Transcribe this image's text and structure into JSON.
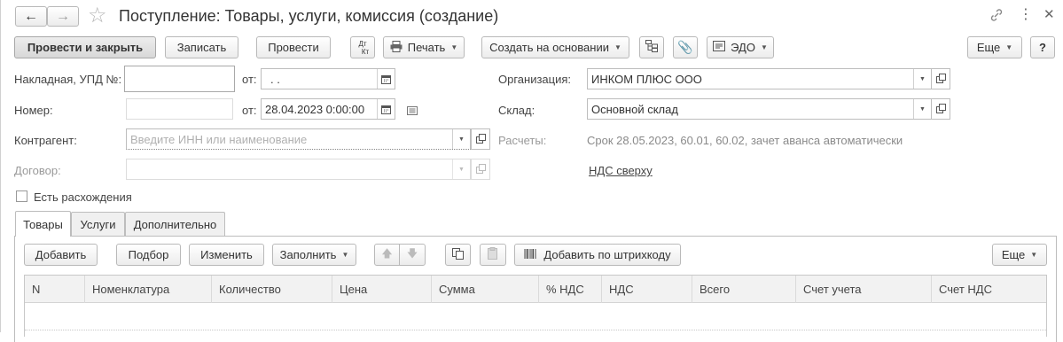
{
  "window": {
    "title": "Поступление: Товары, услуги, комиссия (создание)"
  },
  "toolbar": {
    "post_close": "Провести и закрыть",
    "save": "Записать",
    "post": "Провести",
    "dtkt_top": "Дт",
    "dtkt_bottom": "Кт",
    "print": "Печать",
    "create_based": "Создать на основании",
    "edo": "ЭДО",
    "more": "Еще",
    "help": "?"
  },
  "form": {
    "invoice_label": "Накладная, УПД №:",
    "invoice_number": "",
    "from_label_1": "от:",
    "invoice_date": " .  .",
    "number_label": "Номер:",
    "number_value": "",
    "from_label_2": "от:",
    "doc_date": "28.04.2023  0:00:00",
    "counterparty_label": "Контрагент:",
    "counterparty_placeholder": "Введите ИНН или наименование",
    "contract_label": "Договор:",
    "contract_value": "",
    "organization_label": "Организация:",
    "organization_value": "ИНКОМ ПЛЮС ООО",
    "warehouse_label": "Склад:",
    "warehouse_value": "Основной склад",
    "settlements_label": "Расчеты:",
    "settlements_value": "Срок 28.05.2023, 60.01, 60.02, зачет аванса автоматически",
    "vat_link": "НДС сверху",
    "discrepancy_label": "Есть расхождения",
    "discrepancy_checked": false
  },
  "tabs": [
    {
      "label": "Товары",
      "active": true
    },
    {
      "label": "Услуги",
      "active": false
    },
    {
      "label": "Дополнительно",
      "active": false
    }
  ],
  "goods_toolbar": {
    "add": "Добавить",
    "select": "Подбор",
    "change": "Изменить",
    "fill": "Заполнить",
    "add_by_barcode": "Добавить по штрихкоду",
    "more": "Еще"
  },
  "table": {
    "columns": [
      "N",
      "Номенклатура",
      "Количество",
      "Цена",
      "Сумма",
      "% НДС",
      "НДС",
      "Всего",
      "Счет учета",
      "Счет НДС"
    ],
    "rows": []
  },
  "colors": {
    "border": "#bdbdbd",
    "header_bg": "#f2f2f2",
    "primary_btn": "#dedede"
  }
}
